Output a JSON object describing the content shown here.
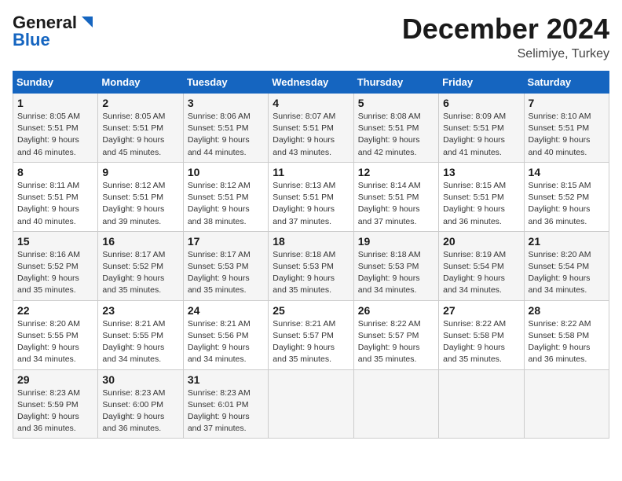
{
  "header": {
    "logo_line1": "General",
    "logo_line2": "Blue",
    "month": "December 2024",
    "location": "Selimiye, Turkey"
  },
  "weekdays": [
    "Sunday",
    "Monday",
    "Tuesday",
    "Wednesday",
    "Thursday",
    "Friday",
    "Saturday"
  ],
  "weeks": [
    [
      {
        "day": "1",
        "sunrise": "Sunrise: 8:05 AM",
        "sunset": "Sunset: 5:51 PM",
        "daylight": "Daylight: 9 hours and 46 minutes."
      },
      {
        "day": "2",
        "sunrise": "Sunrise: 8:05 AM",
        "sunset": "Sunset: 5:51 PM",
        "daylight": "Daylight: 9 hours and 45 minutes."
      },
      {
        "day": "3",
        "sunrise": "Sunrise: 8:06 AM",
        "sunset": "Sunset: 5:51 PM",
        "daylight": "Daylight: 9 hours and 44 minutes."
      },
      {
        "day": "4",
        "sunrise": "Sunrise: 8:07 AM",
        "sunset": "Sunset: 5:51 PM",
        "daylight": "Daylight: 9 hours and 43 minutes."
      },
      {
        "day": "5",
        "sunrise": "Sunrise: 8:08 AM",
        "sunset": "Sunset: 5:51 PM",
        "daylight": "Daylight: 9 hours and 42 minutes."
      },
      {
        "day": "6",
        "sunrise": "Sunrise: 8:09 AM",
        "sunset": "Sunset: 5:51 PM",
        "daylight": "Daylight: 9 hours and 41 minutes."
      },
      {
        "day": "7",
        "sunrise": "Sunrise: 8:10 AM",
        "sunset": "Sunset: 5:51 PM",
        "daylight": "Daylight: 9 hours and 40 minutes."
      }
    ],
    [
      {
        "day": "8",
        "sunrise": "Sunrise: 8:11 AM",
        "sunset": "Sunset: 5:51 PM",
        "daylight": "Daylight: 9 hours and 40 minutes."
      },
      {
        "day": "9",
        "sunrise": "Sunrise: 8:12 AM",
        "sunset": "Sunset: 5:51 PM",
        "daylight": "Daylight: 9 hours and 39 minutes."
      },
      {
        "day": "10",
        "sunrise": "Sunrise: 8:12 AM",
        "sunset": "Sunset: 5:51 PM",
        "daylight": "Daylight: 9 hours and 38 minutes."
      },
      {
        "day": "11",
        "sunrise": "Sunrise: 8:13 AM",
        "sunset": "Sunset: 5:51 PM",
        "daylight": "Daylight: 9 hours and 37 minutes."
      },
      {
        "day": "12",
        "sunrise": "Sunrise: 8:14 AM",
        "sunset": "Sunset: 5:51 PM",
        "daylight": "Daylight: 9 hours and 37 minutes."
      },
      {
        "day": "13",
        "sunrise": "Sunrise: 8:15 AM",
        "sunset": "Sunset: 5:51 PM",
        "daylight": "Daylight: 9 hours and 36 minutes."
      },
      {
        "day": "14",
        "sunrise": "Sunrise: 8:15 AM",
        "sunset": "Sunset: 5:52 PM",
        "daylight": "Daylight: 9 hours and 36 minutes."
      }
    ],
    [
      {
        "day": "15",
        "sunrise": "Sunrise: 8:16 AM",
        "sunset": "Sunset: 5:52 PM",
        "daylight": "Daylight: 9 hours and 35 minutes."
      },
      {
        "day": "16",
        "sunrise": "Sunrise: 8:17 AM",
        "sunset": "Sunset: 5:52 PM",
        "daylight": "Daylight: 9 hours and 35 minutes."
      },
      {
        "day": "17",
        "sunrise": "Sunrise: 8:17 AM",
        "sunset": "Sunset: 5:53 PM",
        "daylight": "Daylight: 9 hours and 35 minutes."
      },
      {
        "day": "18",
        "sunrise": "Sunrise: 8:18 AM",
        "sunset": "Sunset: 5:53 PM",
        "daylight": "Daylight: 9 hours and 35 minutes."
      },
      {
        "day": "19",
        "sunrise": "Sunrise: 8:18 AM",
        "sunset": "Sunset: 5:53 PM",
        "daylight": "Daylight: 9 hours and 34 minutes."
      },
      {
        "day": "20",
        "sunrise": "Sunrise: 8:19 AM",
        "sunset": "Sunset: 5:54 PM",
        "daylight": "Daylight: 9 hours and 34 minutes."
      },
      {
        "day": "21",
        "sunrise": "Sunrise: 8:20 AM",
        "sunset": "Sunset: 5:54 PM",
        "daylight": "Daylight: 9 hours and 34 minutes."
      }
    ],
    [
      {
        "day": "22",
        "sunrise": "Sunrise: 8:20 AM",
        "sunset": "Sunset: 5:55 PM",
        "daylight": "Daylight: 9 hours and 34 minutes."
      },
      {
        "day": "23",
        "sunrise": "Sunrise: 8:21 AM",
        "sunset": "Sunset: 5:55 PM",
        "daylight": "Daylight: 9 hours and 34 minutes."
      },
      {
        "day": "24",
        "sunrise": "Sunrise: 8:21 AM",
        "sunset": "Sunset: 5:56 PM",
        "daylight": "Daylight: 9 hours and 34 minutes."
      },
      {
        "day": "25",
        "sunrise": "Sunrise: 8:21 AM",
        "sunset": "Sunset: 5:57 PM",
        "daylight": "Daylight: 9 hours and 35 minutes."
      },
      {
        "day": "26",
        "sunrise": "Sunrise: 8:22 AM",
        "sunset": "Sunset: 5:57 PM",
        "daylight": "Daylight: 9 hours and 35 minutes."
      },
      {
        "day": "27",
        "sunrise": "Sunrise: 8:22 AM",
        "sunset": "Sunset: 5:58 PM",
        "daylight": "Daylight: 9 hours and 35 minutes."
      },
      {
        "day": "28",
        "sunrise": "Sunrise: 8:22 AM",
        "sunset": "Sunset: 5:58 PM",
        "daylight": "Daylight: 9 hours and 36 minutes."
      }
    ],
    [
      {
        "day": "29",
        "sunrise": "Sunrise: 8:23 AM",
        "sunset": "Sunset: 5:59 PM",
        "daylight": "Daylight: 9 hours and 36 minutes."
      },
      {
        "day": "30",
        "sunrise": "Sunrise: 8:23 AM",
        "sunset": "Sunset: 6:00 PM",
        "daylight": "Daylight: 9 hours and 36 minutes."
      },
      {
        "day": "31",
        "sunrise": "Sunrise: 8:23 AM",
        "sunset": "Sunset: 6:01 PM",
        "daylight": "Daylight: 9 hours and 37 minutes."
      },
      null,
      null,
      null,
      null
    ]
  ]
}
